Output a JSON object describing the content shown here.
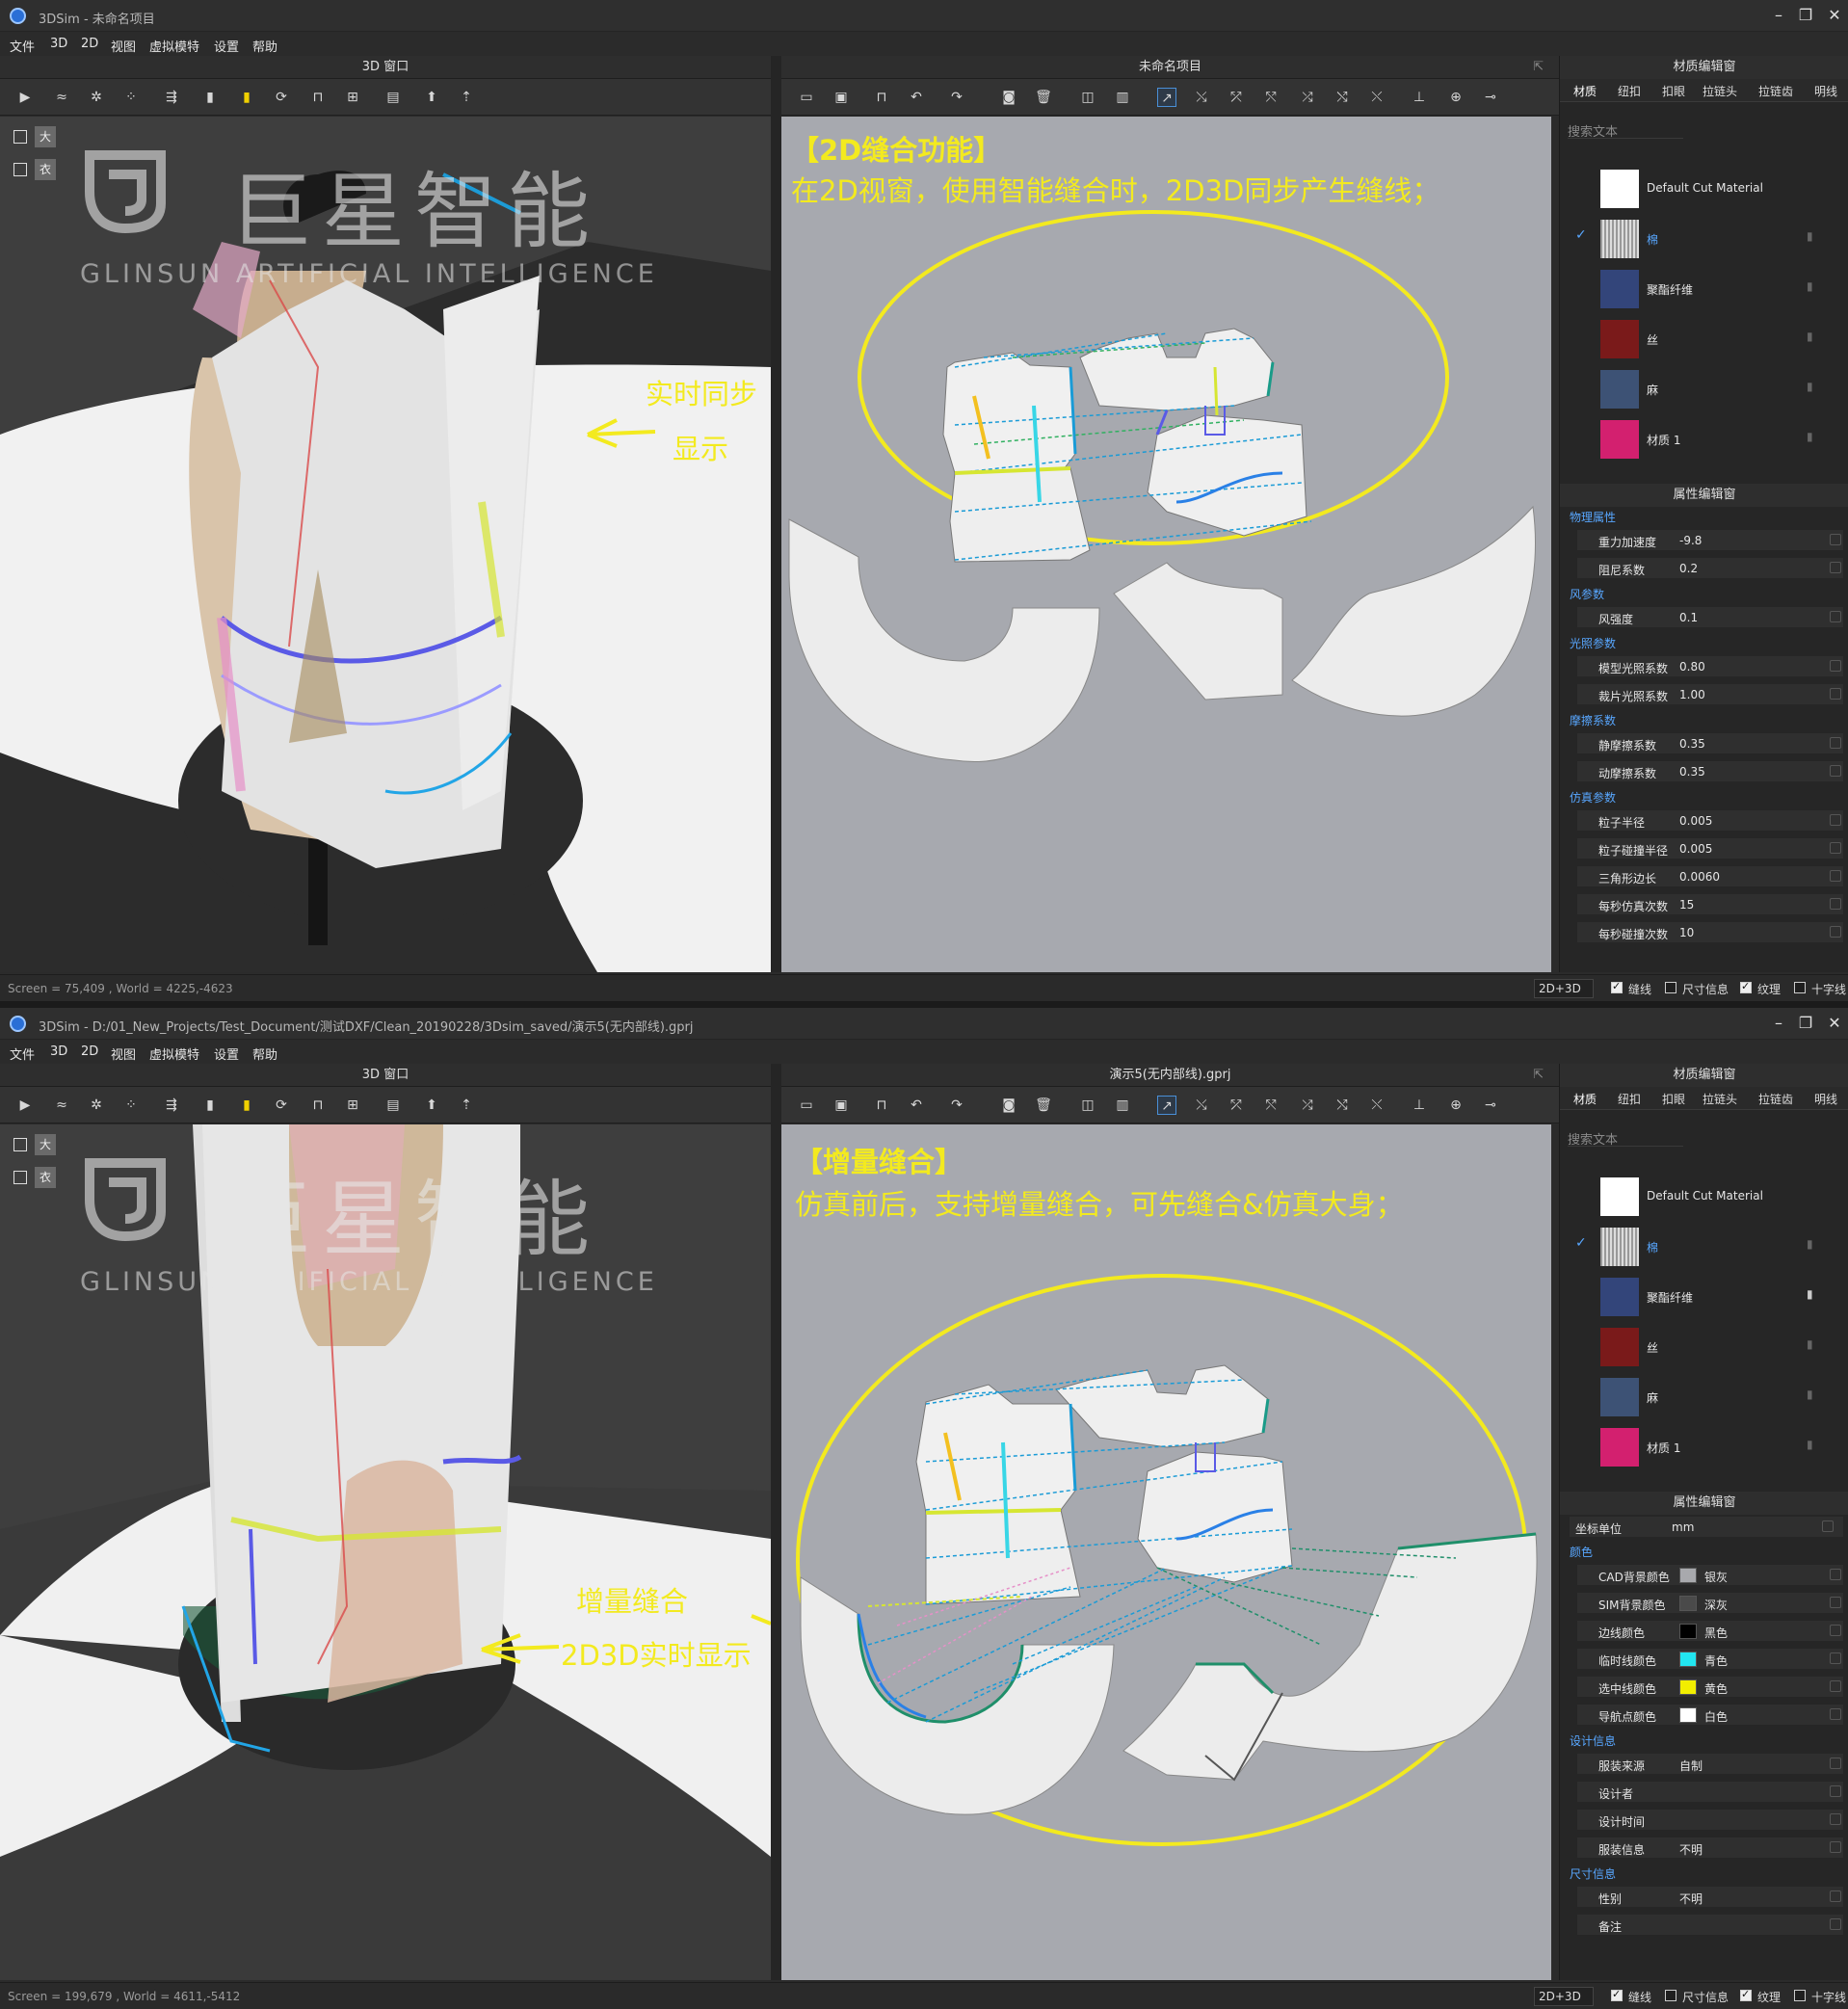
{
  "win1": {
    "title": "3DSim - 未命名项目",
    "menu": [
      "文件",
      "3D",
      "2D",
      "视图",
      "虚拟模特",
      "设置",
      "帮助"
    ],
    "panel3d_title": "3D 窗口",
    "panel2d_title": "未命名项目",
    "annotation_title": "【2D缝合功能】",
    "annotation_body": "在2D视窗，使用智能缝合时，2D3D同步产生缝线；",
    "arrow_label_1": "实时同步",
    "arrow_label_2": "显示",
    "status_left": "Screen = 75,409 , World = 4225,-4623"
  },
  "win2": {
    "title": "3DSim - D:/01_New_Projects/Test_Document/测试DXF/Clean_20190228/3Dsim_saved/演示5(无内部线).gprj",
    "menu": [
      "文件",
      "3D",
      "2D",
      "视图",
      "虚拟模特",
      "设置",
      "帮助"
    ],
    "panel3d_title": "3D 窗口",
    "panel2d_title": "演示5(无内部线).gprj",
    "annotation_title": "【增量缝合】",
    "annotation_body": "仿真前后，支持增量缝合，可先缝合&仿真大身；",
    "arrow_label_1": "增量缝合",
    "arrow_label_2": "2D3D实时显示",
    "status_left": "Screen = 199,679 , World = 4611,-5412"
  },
  "watermark": {
    "cn": "巨星智能",
    "en": "GLINSUN  ARTIFICIAL INTELLIGENCE"
  },
  "side_icons": [
    "大",
    "衣"
  ],
  "status": {
    "mode": "2D+3D",
    "checks": [
      {
        "label": "缝线",
        "checked": true
      },
      {
        "label": "尺寸信息",
        "checked": false
      },
      {
        "label": "纹理",
        "checked": true
      },
      {
        "label": "十字线",
        "checked": false
      }
    ]
  },
  "material_panel": {
    "title": "材质编辑窗",
    "tabs": [
      "材质",
      "纽扣",
      "扣眼",
      "拉链头",
      "拉链齿",
      "明线"
    ],
    "search_placeholder": "搜索文本",
    "materials": [
      {
        "name": "Default Cut Material",
        "color": "#ffffff",
        "selected": false
      },
      {
        "name": "棉",
        "color": "#bfbfbf",
        "selected": true
      },
      {
        "name": "聚酯纤维",
        "color": "#33457a",
        "selected": false
      },
      {
        "name": "丝",
        "color": "#7a1a1a",
        "selected": false
      },
      {
        "name": "麻",
        "color": "#3d5275",
        "selected": false
      },
      {
        "name": "材质 1",
        "color": "#d3206f",
        "selected": false
      }
    ]
  },
  "property_panel": {
    "title": "属性编辑窗",
    "win1_sections": [
      {
        "name": "物理属性",
        "rows": [
          [
            "重力加速度",
            "-9.8"
          ],
          [
            "阻尼系数",
            "0.2"
          ]
        ]
      },
      {
        "name": "风参数",
        "rows": [
          [
            "风强度",
            "0.1"
          ]
        ]
      },
      {
        "name": "光照参数",
        "rows": [
          [
            "模型光照系数",
            "0.80"
          ],
          [
            "裁片光照系数",
            "1.00"
          ]
        ]
      },
      {
        "name": "摩擦系数",
        "rows": [
          [
            "静摩擦系数",
            "0.35"
          ],
          [
            "动摩擦系数",
            "0.35"
          ]
        ]
      },
      {
        "name": "仿真参数",
        "rows": [
          [
            "粒子半径",
            "0.005"
          ],
          [
            "粒子碰撞半径",
            "0.005"
          ],
          [
            "三角形边长",
            "0.0060"
          ],
          [
            "每秒仿真次数",
            "15"
          ],
          [
            "每秒碰撞次数",
            "10"
          ]
        ]
      }
    ],
    "win2_unit": [
      "坐标单位",
      "mm"
    ],
    "win2_colors_title": "颜色",
    "win2_colors": [
      {
        "label": "CAD背景颜色",
        "name": "银灰",
        "color": "#a8a9ad"
      },
      {
        "label": "SIM背景颜色",
        "name": "深灰",
        "color": "#4a4a4a"
      },
      {
        "label": "边线颜色",
        "name": "黑色",
        "color": "#000000"
      },
      {
        "label": "临时线颜色",
        "name": "青色",
        "color": "#22e6f0"
      },
      {
        "label": "选中线颜色",
        "name": "黄色",
        "color": "#f2ee00"
      },
      {
        "label": "导航点颜色",
        "name": "白色",
        "color": "#ffffff"
      }
    ],
    "win2_design_title": "设计信息",
    "win2_design": [
      [
        "服装来源",
        "自制"
      ],
      [
        "设计者",
        ""
      ],
      [
        "设计时间",
        ""
      ],
      [
        "服装信息",
        "不明"
      ]
    ],
    "win2_size_title": "尺寸信息",
    "win2_size": [
      [
        "性别",
        "不明"
      ],
      [
        "备注",
        ""
      ]
    ]
  }
}
